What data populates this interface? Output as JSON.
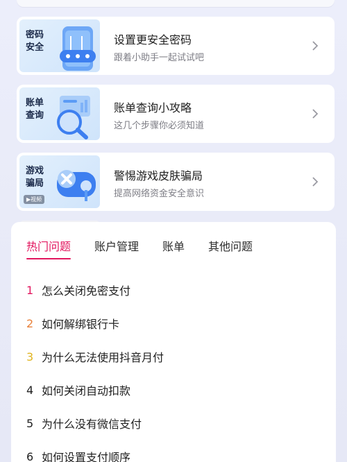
{
  "cards": [
    {
      "thumb_label": "密码安全",
      "title": "设置更安全密码",
      "subtitle": "跟着小助手一起试试吧",
      "icon": "phone-password-icon"
    },
    {
      "thumb_label": "账单查询",
      "title": "账单查询小攻略",
      "subtitle": "这几个步骤你必须知道",
      "icon": "bill-search-icon"
    },
    {
      "thumb_label": "游戏骗局",
      "title": "警惕游戏皮肤骗局",
      "subtitle": "提高网络资金安全意识",
      "icon": "gamepad-warning-icon",
      "video_tag": "▶视频"
    }
  ],
  "tabs": [
    {
      "label": "热门问题",
      "active": true
    },
    {
      "label": "账户管理",
      "active": false
    },
    {
      "label": "账单",
      "active": false
    },
    {
      "label": "其他问题",
      "active": false
    }
  ],
  "questions": [
    {
      "num": "1",
      "text": "怎么关闭免密支付"
    },
    {
      "num": "2",
      "text": "如何解绑银行卡"
    },
    {
      "num": "3",
      "text": "为什么无法使用抖音月付"
    },
    {
      "num": "4",
      "text": "如何关闭自动扣款"
    },
    {
      "num": "5",
      "text": "为什么没有微信支付"
    },
    {
      "num": "6",
      "text": "如何设置支付顺序"
    }
  ],
  "colors": {
    "accent": "#e2165e",
    "rank2": "#e8803a",
    "rank3": "#e0b420"
  }
}
